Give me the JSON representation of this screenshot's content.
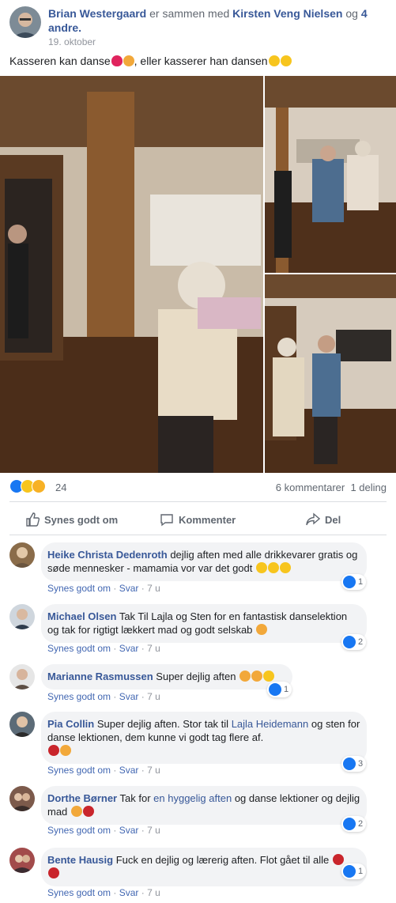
{
  "post": {
    "author": "Brian Westergaard",
    "with_text": "er sammen med",
    "tagged": "Kirsten Veng Nielsen",
    "and_text": "og",
    "others": "4 andre.",
    "date": "19. oktober",
    "text": "Kasseren kan danse",
    "text2": ", eller kasserer han dansen"
  },
  "stats": {
    "reaction_count": "24",
    "comments": "6 kommentarer",
    "shares": "1 deling"
  },
  "actions": {
    "like": "Synes godt om",
    "comment": "Kommenter",
    "share": "Del"
  },
  "comments": [
    {
      "name": "Heike Christa Dedenroth",
      "text": "dejlig aften med alle drikkevarer gratis og søde mennesker - mamamia vor var det godt",
      "likes": "1"
    },
    {
      "name": "Michael Olsen",
      "text": "Tak Til Lajla og Sten for en fantastisk danselektion og tak for rigtigt lækkert mad og godt selskab",
      "likes": "2"
    },
    {
      "name": "Marianne Rasmussen",
      "text": "Super dejlig aften",
      "likes": "1"
    },
    {
      "name": "Pia Collin",
      "text_a": "Super dejlig aften. Stor tak til",
      "link": "Lajla Heidemann",
      "text_b": "og sten for danse lektionen, dem kunne vi godt tag flere af.",
      "likes": "3"
    },
    {
      "name": "Dorthe Børner",
      "text_a": "Tak for",
      "link": "en hyggelig aften",
      "text_b": "og danse lektioner og dejlig mad",
      "likes": "2"
    },
    {
      "name": "Bente Hausig",
      "text": "Fuck en dejlig og lærerig aften. Flot gået til alle",
      "likes": "1"
    }
  ],
  "comment_meta": {
    "like": "Synes godt om",
    "reply": "Svar",
    "sep": "·",
    "time": "7 u"
  }
}
